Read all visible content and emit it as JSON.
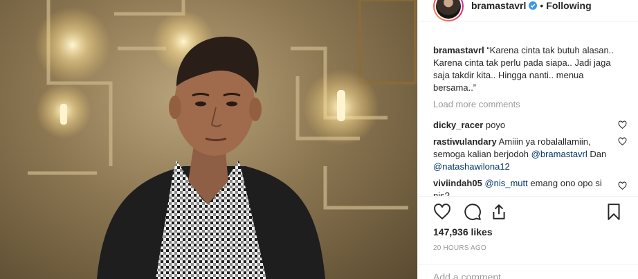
{
  "header": {
    "username": "bramastavrl",
    "separator": "•",
    "follow_status": "Following"
  },
  "caption": {
    "username": "bramastavrl",
    "text": "“Karena cinta tak butuh alasan.. Karena cinta tak perlu pada siapa.. Jadi jaga saja takdir kita.. Hingga nanti.. menua bersama..”"
  },
  "load_more": "Load more comments",
  "comments": [
    {
      "username": "dicky_racer",
      "text": "poyo"
    },
    {
      "username": "rastiwulandary",
      "text_a": "Amiiin ya robalallamiin, semoga kalian berjodoh",
      "mention_a": "@bramastavrl",
      "text_b": "Dan",
      "mention_b": "@natashawilona12"
    },
    {
      "username": "viviindah05",
      "mention": "@nis_mutt",
      "text": "emang ono opo si nis?"
    }
  ],
  "likes": "147,936 likes",
  "timestamp": "20 HOURS AGO",
  "add_comment_placeholder": "Add a comment...",
  "icons": [
    "heart-icon",
    "comment-icon",
    "share-icon",
    "bookmark-icon",
    "verified-badge-icon"
  ],
  "colors": {
    "verified": "#3897f0",
    "mention": "#003569",
    "muted": "#999999"
  }
}
